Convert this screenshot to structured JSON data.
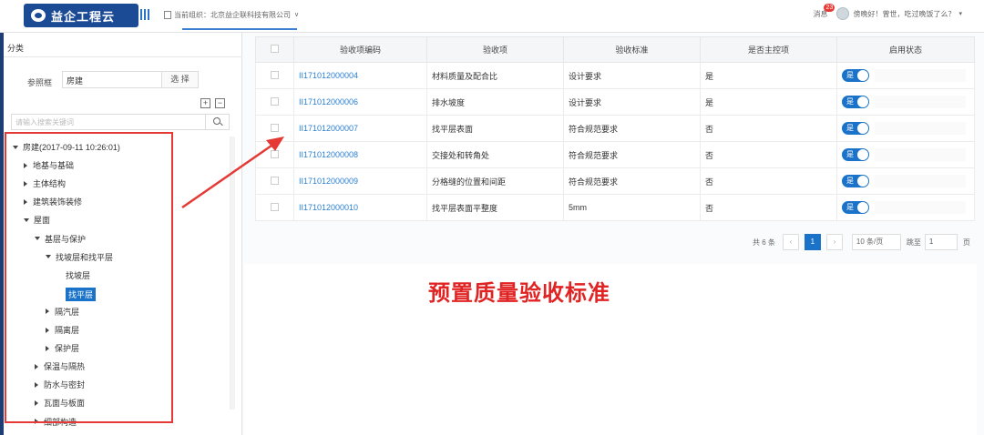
{
  "header": {
    "logo_text": "益企工程云",
    "org_label": "当前组织：北京益企联科技有限公司",
    "message_label": "消息",
    "message_count": "23",
    "greeting": "傍晚好！曾世，吃过晚饭了么？"
  },
  "sidebar": {
    "title": "分类",
    "ref_label": "参照框",
    "ref_value": "房建",
    "select_label": "选 择",
    "expand_all": "+",
    "collapse_all": "−",
    "search_placeholder": "请输入搜索关键词",
    "tree": [
      {
        "label": "房建(2017-09-11 10:26:01)",
        "level": 0,
        "state": "open"
      },
      {
        "label": "地基与基础",
        "level": 1,
        "state": "closed"
      },
      {
        "label": "主体结构",
        "level": 1,
        "state": "closed"
      },
      {
        "label": "建筑装饰装修",
        "level": 1,
        "state": "closed"
      },
      {
        "label": "屋面",
        "level": 1,
        "state": "open"
      },
      {
        "label": "基层与保护",
        "level": 2,
        "state": "open"
      },
      {
        "label": "找坡层和找平层",
        "level": 3,
        "state": "open"
      },
      {
        "label": "找坡层",
        "level": 4,
        "state": "leaf"
      },
      {
        "label": "找平层",
        "level": 4,
        "state": "selected"
      },
      {
        "label": "隔汽层",
        "level": 3,
        "state": "closed"
      },
      {
        "label": "隔离层",
        "level": 3,
        "state": "closed"
      },
      {
        "label": "保护层",
        "level": 3,
        "state": "closed"
      },
      {
        "label": "保温与隔热",
        "level": 2,
        "state": "closed"
      },
      {
        "label": "防水与密封",
        "level": 2,
        "state": "closed"
      },
      {
        "label": "瓦面与板面",
        "level": 2,
        "state": "closed"
      },
      {
        "label": "细部构造",
        "level": 2,
        "state": "closed"
      }
    ]
  },
  "table": {
    "headers": [
      "验收项编码",
      "验收项",
      "验收标准",
      "是否主控项",
      "启用状态"
    ],
    "rows": [
      {
        "code": "II171012000004",
        "item": "材料质量及配合比",
        "standard": "设计要求",
        "main": "是",
        "status": "是"
      },
      {
        "code": "II171012000006",
        "item": "排水坡度",
        "standard": "设计要求",
        "main": "是",
        "status": "是"
      },
      {
        "code": "II171012000007",
        "item": "找平层表面",
        "standard": "符合规范要求",
        "main": "否",
        "status": "是"
      },
      {
        "code": "II171012000008",
        "item": "交接处和转角处",
        "standard": "符合规范要求",
        "main": "否",
        "status": "是"
      },
      {
        "code": "II171012000009",
        "item": "分格缝的位置和间距",
        "standard": "符合规范要求",
        "main": "否",
        "status": "是"
      },
      {
        "code": "II171012000010",
        "item": "找平层表面平整度",
        "standard": "5mm",
        "main": "否",
        "status": "是"
      }
    ]
  },
  "pagination": {
    "total": "共 6 条",
    "prev": "‹",
    "current": "1",
    "next": "›",
    "page_size": "10 条/页",
    "jump_label": "跳至",
    "jump_value": "1",
    "page_unit": "页"
  },
  "annotation": {
    "caption": "预置质量验收标准",
    "color": "#e02424"
  }
}
